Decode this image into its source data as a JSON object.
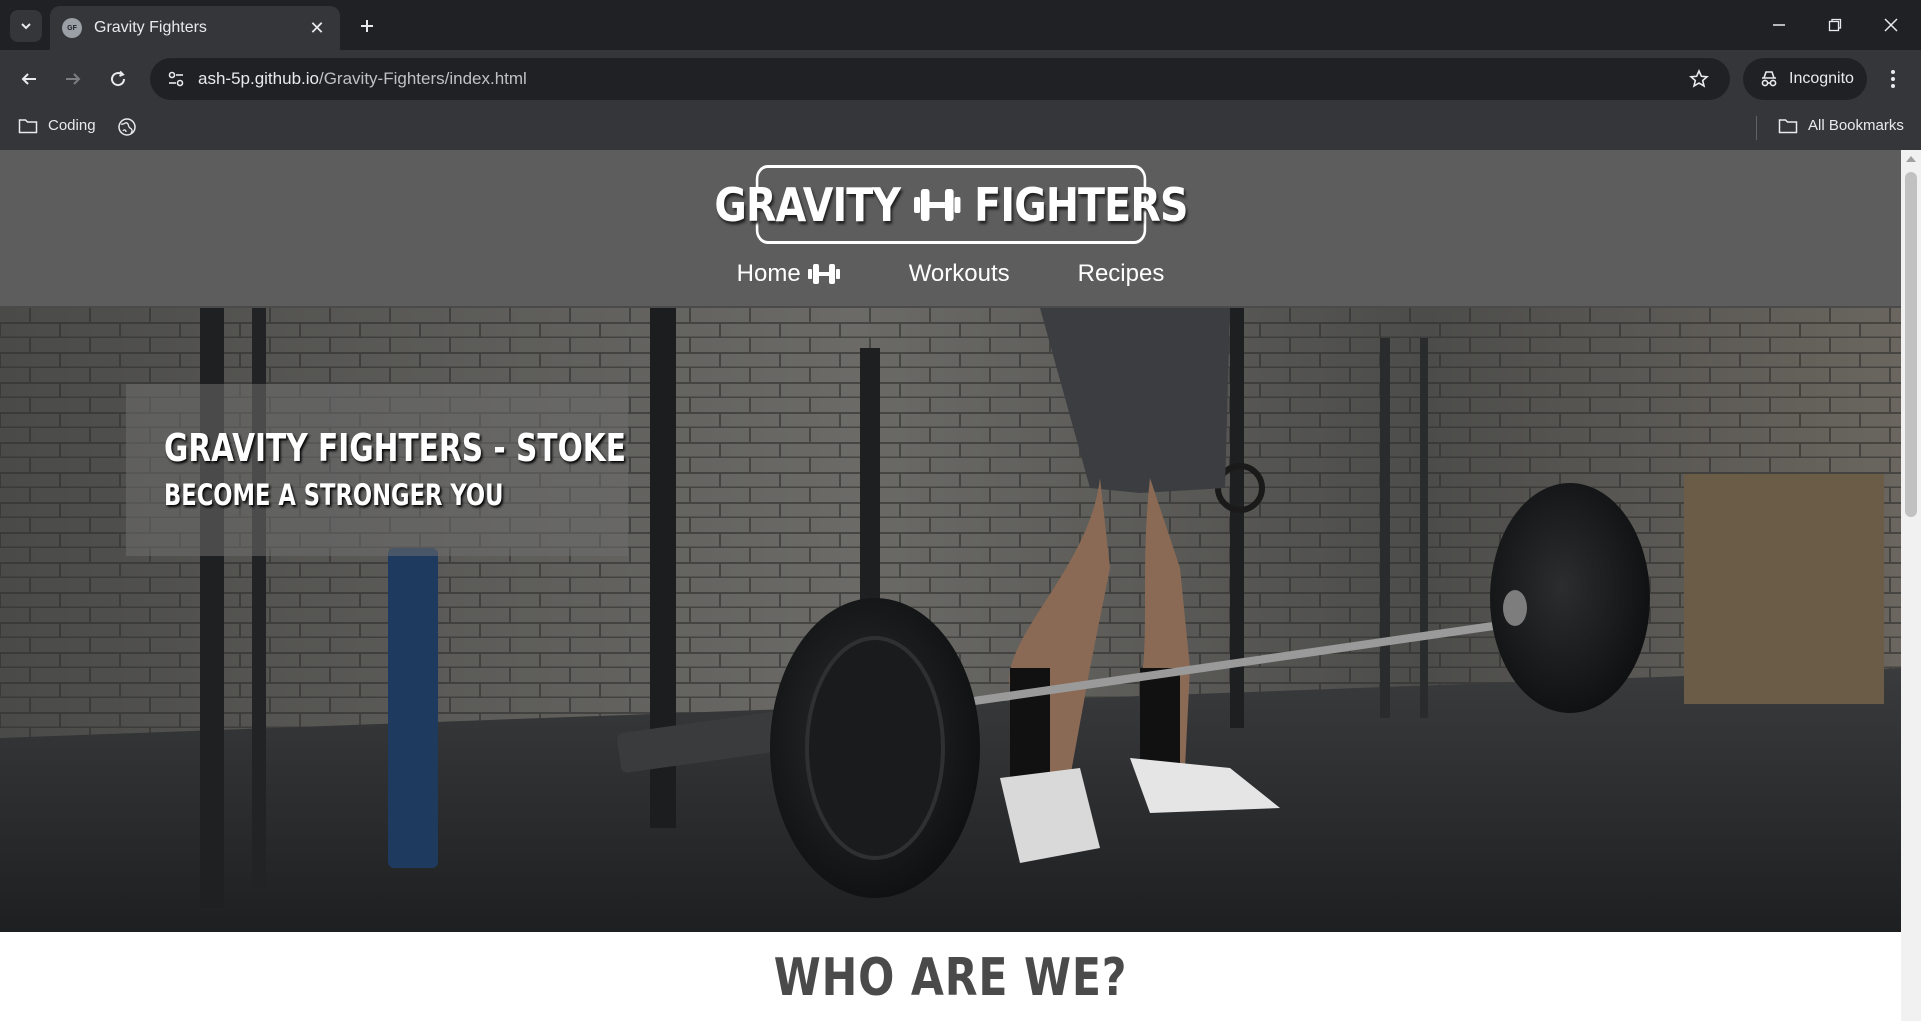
{
  "browser": {
    "tab_title": "Gravity Fighters",
    "url_host": "ash-5p.github.io",
    "url_path": "/Gravity-Fighters/index.html",
    "incognito_label": "Incognito",
    "bookmarks": [
      {
        "label": "Coding",
        "icon": "folder-icon"
      },
      {
        "label": "",
        "icon": "globe-icon"
      }
    ],
    "all_bookmarks_label": "All Bookmarks"
  },
  "site": {
    "logo_left": "GRAVITY",
    "logo_right": "FIGHTERS",
    "nav": [
      {
        "label": "Home",
        "icon": "dumbbell-icon",
        "active": true
      },
      {
        "label": "Workouts"
      },
      {
        "label": "Recipes"
      }
    ],
    "hero": {
      "title": "GRAVITY FIGHTERS - STOKE",
      "subtitle": "BECOME A STRONGER YOU"
    },
    "section_heading": "WHO ARE WE?"
  },
  "colors": {
    "header_bg": "#5d5d5d",
    "chrome_dark": "#202124",
    "chrome_toolbar": "#35363a"
  }
}
